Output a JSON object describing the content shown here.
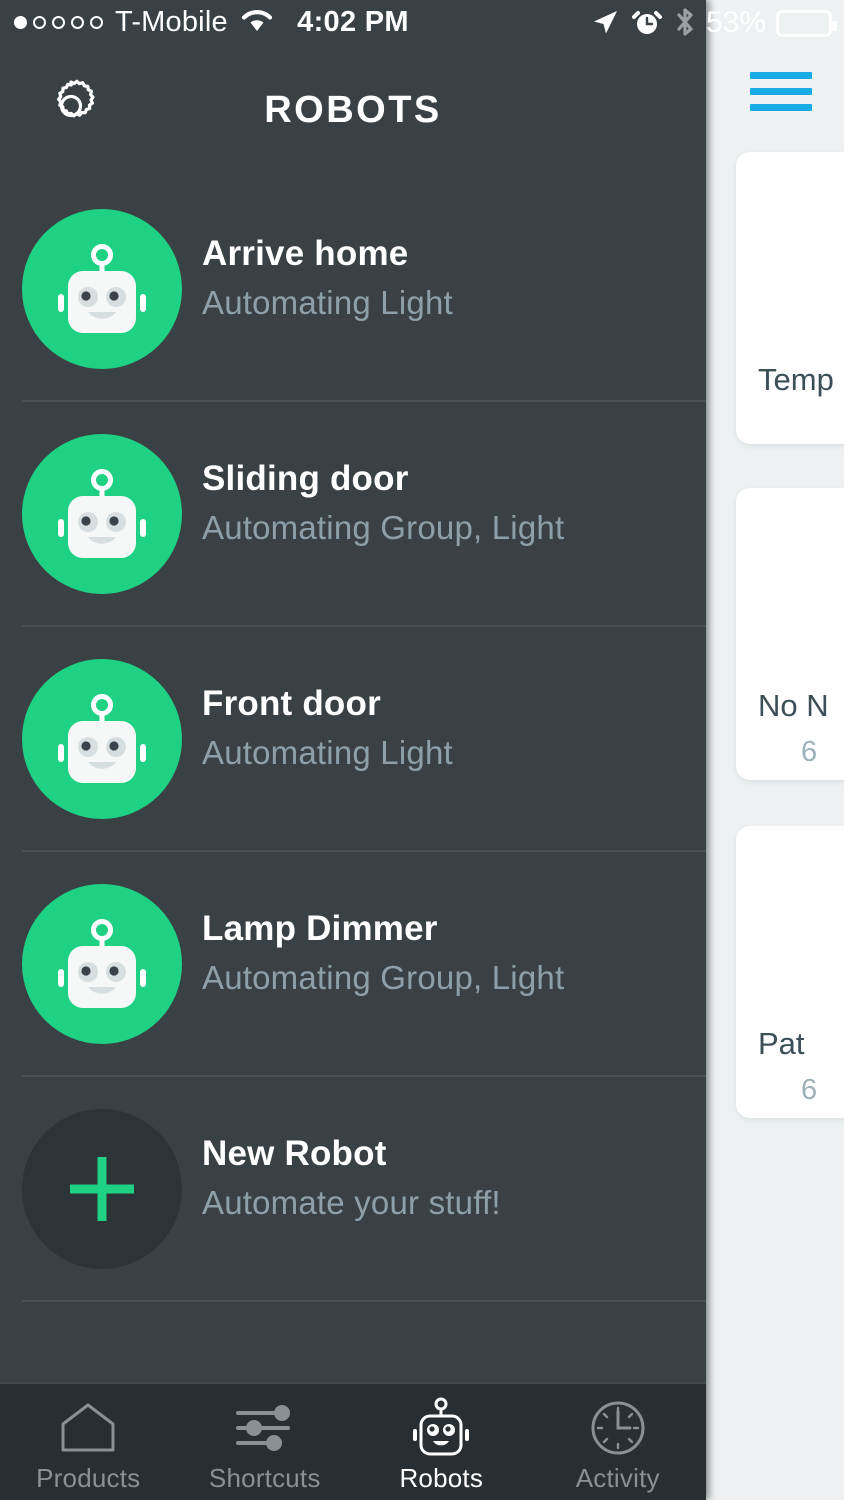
{
  "status_bar": {
    "signal_dots_total": 5,
    "signal_dots_filled": 1,
    "carrier": "T-Mobile",
    "wifi_icon": "wifi-icon",
    "time": "4:02 PM",
    "location_icon": "location-arrow-icon",
    "alarm_icon": "alarm-clock-icon",
    "bluetooth_icon": "bluetooth-icon",
    "battery_percent": "53%",
    "battery_level": 53
  },
  "navbar": {
    "settings_icon": "gear-icon",
    "title": "ROBOTS"
  },
  "robots": [
    {
      "name": "Arrive home",
      "subtitle": "Automating Light",
      "avatar": "robot-icon",
      "avatar_style": "green"
    },
    {
      "name": "Sliding door",
      "subtitle": "Automating Group, Light",
      "avatar": "robot-icon",
      "avatar_style": "green"
    },
    {
      "name": "Front door",
      "subtitle": "Automating Light",
      "avatar": "robot-icon",
      "avatar_style": "green"
    },
    {
      "name": "Lamp Dimmer",
      "subtitle": "Automating Group, Light",
      "avatar": "robot-icon",
      "avatar_style": "green"
    },
    {
      "name": "New Robot",
      "subtitle": "Automate your stuff!",
      "avatar": "plus-icon",
      "avatar_style": "plus"
    }
  ],
  "tabbar": {
    "tabs": [
      {
        "label": "Products",
        "icon": "house-icon",
        "active": false
      },
      {
        "label": "Shortcuts",
        "icon": "sliders-icon",
        "active": false
      },
      {
        "label": "Robots",
        "icon": "robot-icon",
        "active": true
      },
      {
        "label": "Activity",
        "icon": "clock-icon",
        "active": false
      }
    ]
  },
  "background_app": {
    "menu_icon": "hamburger-menu-icon",
    "cards": [
      {
        "title": "Temp",
        "subtitle": ""
      },
      {
        "title": "No N",
        "subtitle": "6"
      },
      {
        "title": "Pat",
        "subtitle": "6"
      }
    ]
  },
  "colors": {
    "accent_green": "#1FD183",
    "panel_dark": "#3A4145",
    "tabbar_dark": "#292E32",
    "subtitle_gray": "#8DA0A9",
    "bg_app_blue": "#16ABE3",
    "bg_app_surface": "#EDF1F2"
  }
}
